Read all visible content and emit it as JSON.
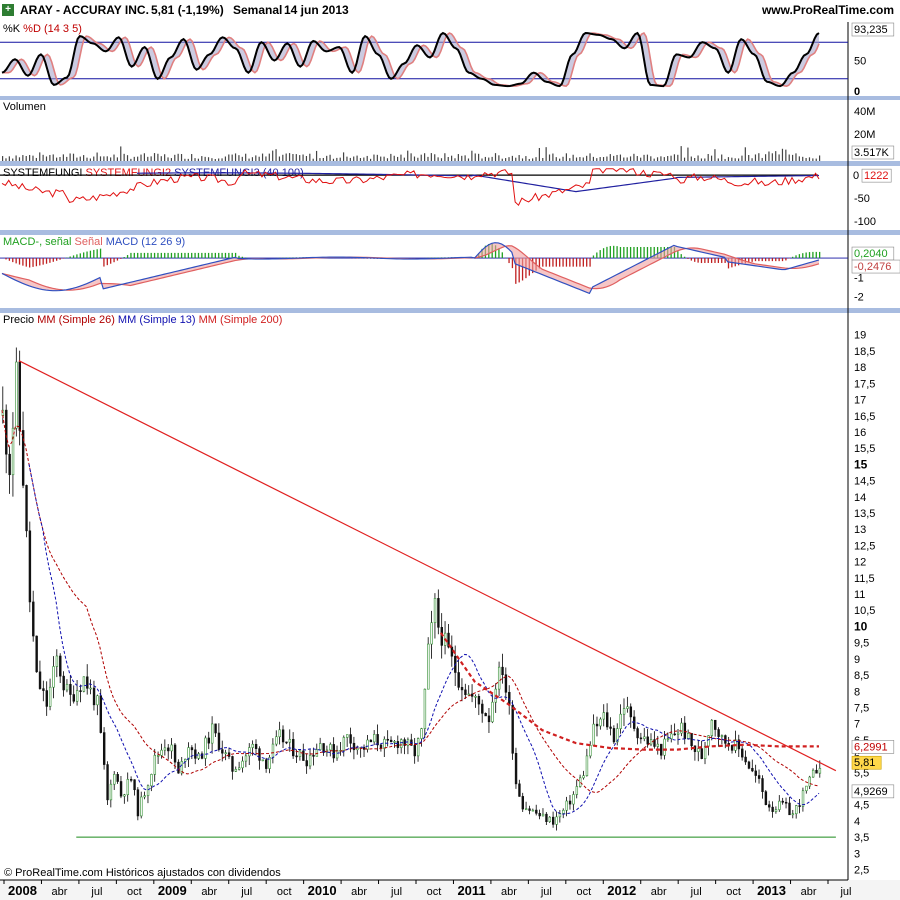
{
  "header": {
    "icon": "cross-icon",
    "ticker": "ARAY - ACCURAY INC.",
    "quote": "5,81 (-1,19%)",
    "period": "Semanal",
    "date": "14 jun 2013",
    "site": "www.ProRealTime.com"
  },
  "footer": "© ProRealTime.com  Históricos ajustados con dividendos",
  "colors": {
    "separator": "#a8bce0",
    "price_up": "#2e8b2e",
    "price_down": "#111111",
    "resistance": "#e02020",
    "support": "#1a8a1a",
    "ma26": "#b00000",
    "ma13": "#1010b0",
    "ma200": "#d02020",
    "stoch_k": "#000000",
    "stoch_d": "#e08080",
    "stoch_fill": "#a0a0c8",
    "fungi2": "#e01010",
    "fungi3": "#2020a0",
    "macd": "#3050c0",
    "signal": "#e06060",
    "hist_pos": "#20a020",
    "hist_neg": "#c02020",
    "label_bg": "#ffffff",
    "label_highlight": "#ffd84a"
  },
  "chart_data": [
    {
      "id": "stochastic",
      "type": "line",
      "title_parts": [
        {
          "text": "%K",
          "color": "#000000"
        },
        {
          "text": " %D",
          "color": "#c00000"
        },
        {
          "text": " (14 3 5)",
          "color": "#c00000"
        }
      ],
      "ylim": [
        0,
        100
      ],
      "ticks": [
        "50",
        "0"
      ],
      "last_label": "93,235",
      "levels": [
        80,
        20
      ],
      "waves": {
        "pivots_k": [
          30,
          52,
          25,
          60,
          10,
          22,
          90,
          78,
          65,
          88,
          40,
          72,
          20,
          55,
          85,
          35,
          60,
          88,
          70,
          30,
          80,
          50,
          78,
          40,
          82,
          65,
          72,
          30,
          90,
          60,
          20,
          45,
          75,
          55,
          95,
          70,
          30,
          20,
          10,
          8,
          12,
          30,
          15,
          8,
          60,
          95,
          92,
          85,
          70,
          95,
          10,
          8,
          60,
          55,
          80,
          70,
          30,
          85,
          60,
          15,
          8,
          30,
          60,
          95
        ]
      }
    },
    {
      "id": "volume",
      "type": "bar",
      "title": "Volumen",
      "ticks": [
        "40M",
        "20M"
      ],
      "last_label": "3.517K"
    },
    {
      "id": "systemfungi",
      "type": "line",
      "title_parts": [
        {
          "text": "SYSTEMFUNGI",
          "color": "#000000"
        },
        {
          "text": " SYSTEMFUNGI2",
          "color": "#e01010"
        },
        {
          "text": " SYSTEMFUNGI3",
          "color": "#2020a0"
        },
        {
          "text": " (40 100)",
          "color": "#2020a0"
        }
      ],
      "ylim": [
        -120,
        20
      ],
      "ticks": [
        "-50",
        "-100"
      ],
      "zero_label": "0",
      "last_label": "1222"
    },
    {
      "id": "macd",
      "type": "line",
      "title_parts": [
        {
          "text": "MACD-",
          "color": "#20a020"
        },
        {
          "text": ", señal",
          "color": "#20a020"
        },
        {
          "text": " Señal",
          "color": "#e06060"
        },
        {
          "text": " MACD",
          "color": "#3050c0"
        },
        {
          "text": " (12 26 9)",
          "color": "#3050c0"
        }
      ],
      "ylim": [
        -2.6,
        1.2
      ],
      "ticks": [
        "-1",
        "-2"
      ],
      "last_labels": [
        "0,2040",
        "-0,2476"
      ]
    },
    {
      "id": "price",
      "type": "candlestick",
      "title_parts": [
        {
          "text": "Precio",
          "color": "#000000"
        },
        {
          "text": " MM",
          "color": "#b00000"
        },
        {
          "text": " (Simple 26)",
          "color": "#b00000"
        },
        {
          "text": " MM",
          "color": "#1010b0"
        },
        {
          "text": " (Simple 13)",
          "color": "#1010b0"
        },
        {
          "text": " MM",
          "color": "#d02020"
        },
        {
          "text": " (Simple 200)",
          "color": "#d02020"
        }
      ],
      "ylim": [
        2.3,
        19.3
      ],
      "yticks": [
        "19",
        "18,5",
        "18",
        "17,5",
        "17",
        "16,5",
        "16",
        "15,5",
        "15",
        "14,5",
        "14",
        "13,5",
        "13",
        "12,5",
        "12",
        "11,5",
        "11",
        "10,5",
        "10",
        "9,5",
        "9",
        "8,5",
        "8",
        "7,5",
        "7",
        "6,5",
        "6",
        "5,5",
        "5",
        "4,5",
        "4",
        "3,5",
        "3",
        "2,5"
      ],
      "ytick_values": [
        19,
        18.5,
        18,
        17.5,
        17,
        16.5,
        16,
        15.5,
        15,
        14.5,
        14,
        13.5,
        13,
        12.5,
        12,
        11.5,
        11,
        10.5,
        10,
        9.5,
        9,
        8.5,
        8,
        7.5,
        7,
        6.5,
        6,
        5.5,
        5,
        4.5,
        4,
        3.5,
        3,
        2.5
      ],
      "bold_ticks": [
        "15",
        "10"
      ],
      "last_labels": [
        {
          "text": "6,2991",
          "value": 6.2991,
          "color": "#c00000",
          "highlight": false
        },
        {
          "text": "5,81",
          "value": 5.81,
          "color": "#000000",
          "highlight": true
        },
        {
          "text": "4,9269",
          "value": 4.9269,
          "color": "#000000",
          "highlight": false
        }
      ],
      "close_path": [
        [
          0,
          16.5
        ],
        [
          2,
          15.0
        ],
        [
          4,
          17.6
        ],
        [
          6,
          14.6
        ],
        [
          8,
          10.8
        ],
        [
          10,
          8.4
        ],
        [
          13,
          7.6
        ],
        [
          16,
          9.0
        ],
        [
          18,
          8.2
        ],
        [
          20,
          7.8
        ],
        [
          24,
          8.4
        ],
        [
          28,
          7.6
        ],
        [
          31,
          4.6
        ],
        [
          33,
          5.6
        ],
        [
          35,
          4.8
        ],
        [
          38,
          5.3
        ],
        [
          40,
          4.3
        ],
        [
          42,
          4.9
        ],
        [
          45,
          5.9
        ],
        [
          48,
          6.4
        ],
        [
          50,
          6.2
        ],
        [
          52,
          5.4
        ],
        [
          55,
          6.4
        ],
        [
          58,
          5.9
        ],
        [
          62,
          6.8
        ],
        [
          65,
          6.2
        ],
        [
          68,
          5.6
        ],
        [
          71,
          5.9
        ],
        [
          74,
          6.3
        ],
        [
          78,
          5.8
        ],
        [
          82,
          6.6
        ],
        [
          86,
          6.2
        ],
        [
          90,
          5.9
        ],
        [
          94,
          6.4
        ],
        [
          98,
          6.1
        ],
        [
          102,
          6.6
        ],
        [
          106,
          6.2
        ],
        [
          110,
          6.5
        ],
        [
          114,
          6.3
        ],
        [
          118,
          6.5
        ],
        [
          122,
          6.1
        ],
        [
          124,
          6.7
        ],
        [
          126,
          9.2
        ],
        [
          128,
          10.6
        ],
        [
          129,
          10.0
        ],
        [
          132,
          9.2
        ],
        [
          135,
          8.4
        ],
        [
          138,
          7.9
        ],
        [
          141,
          7.6
        ],
        [
          144,
          7.2
        ],
        [
          146,
          8.3
        ],
        [
          148,
          8.7
        ],
        [
          150,
          7.4
        ],
        [
          152,
          5.2
        ],
        [
          154,
          4.5
        ],
        [
          157,
          4.3
        ],
        [
          160,
          4.1
        ],
        [
          163,
          4.0
        ],
        [
          166,
          4.3
        ],
        [
          169,
          4.8
        ],
        [
          172,
          5.5
        ],
        [
          175,
          6.8
        ],
        [
          178,
          7.2
        ],
        [
          181,
          6.6
        ],
        [
          184,
          7.6
        ],
        [
          186,
          7.1
        ],
        [
          189,
          6.6
        ],
        [
          192,
          6.4
        ],
        [
          195,
          6.2
        ],
        [
          198,
          6.6
        ],
        [
          201,
          6.9
        ],
        [
          204,
          6.3
        ],
        [
          207,
          6.0
        ],
        [
          210,
          7.2
        ],
        [
          213,
          6.5
        ],
        [
          216,
          6.4
        ],
        [
          219,
          6.1
        ],
        [
          222,
          5.5
        ],
        [
          224,
          5.2
        ],
        [
          226,
          4.6
        ],
        [
          228,
          4.4
        ],
        [
          231,
          4.5
        ],
        [
          234,
          4.2
        ],
        [
          237,
          4.8
        ],
        [
          240,
          5.4
        ],
        [
          242,
          5.81
        ]
      ],
      "resistance": {
        "from": [
          5,
          18.2
        ],
        "to": [
          247,
          5.55
        ]
      },
      "resistance2": {
        "from": [
          131,
          11.2
        ],
        "to": [
          247,
          5.55
        ]
      },
      "support": {
        "from": [
          22,
          3.5
        ],
        "to": [
          247,
          3.5
        ]
      },
      "ma200_points": [
        [
          130,
          9.8
        ],
        [
          140,
          8.3
        ],
        [
          150,
          7.6
        ],
        [
          160,
          6.8
        ],
        [
          170,
          6.4
        ],
        [
          180,
          6.25
        ],
        [
          190,
          6.2
        ],
        [
          200,
          6.2
        ],
        [
          210,
          6.3
        ],
        [
          220,
          6.35
        ],
        [
          230,
          6.3
        ],
        [
          240,
          6.3
        ],
        [
          242,
          6.2991
        ]
      ]
    }
  ],
  "xaxis": {
    "labels": [
      {
        "text": "2008",
        "week": 0,
        "bold": true
      },
      {
        "text": "abr",
        "week": 13,
        "bold": false
      },
      {
        "text": "jul",
        "week": 26,
        "bold": false
      },
      {
        "text": "oct",
        "week": 39,
        "bold": false
      },
      {
        "text": "2009",
        "week": 52,
        "bold": true
      },
      {
        "text": "abr",
        "week": 65,
        "bold": false
      },
      {
        "text": "jul",
        "week": 78,
        "bold": false
      },
      {
        "text": "oct",
        "week": 91,
        "bold": false
      },
      {
        "text": "2010",
        "week": 104,
        "bold": true
      },
      {
        "text": "abr",
        "week": 117,
        "bold": false
      },
      {
        "text": "jul",
        "week": 130,
        "bold": false
      },
      {
        "text": "oct",
        "week": 143,
        "bold": false
      },
      {
        "text": "2011",
        "week": 156,
        "bold": true
      },
      {
        "text": "abr",
        "week": 169,
        "bold": false
      },
      {
        "text": "jul",
        "week": 182,
        "bold": false
      },
      {
        "text": "oct",
        "week": 195,
        "bold": false
      },
      {
        "text": "2012",
        "week": 208,
        "bold": true
      },
      {
        "text": "abr",
        "week": 221,
        "bold": false
      },
      {
        "text": "jul",
        "week": 234,
        "bold": false
      },
      {
        "text": "oct",
        "week": 247,
        "bold": false
      },
      {
        "text": "2013",
        "week": 260,
        "bold": true
      },
      {
        "text": "abr",
        "week": 273,
        "bold": false
      },
      {
        "text": "jul",
        "week": 286,
        "bold": false
      }
    ],
    "total_weeks": 294
  }
}
